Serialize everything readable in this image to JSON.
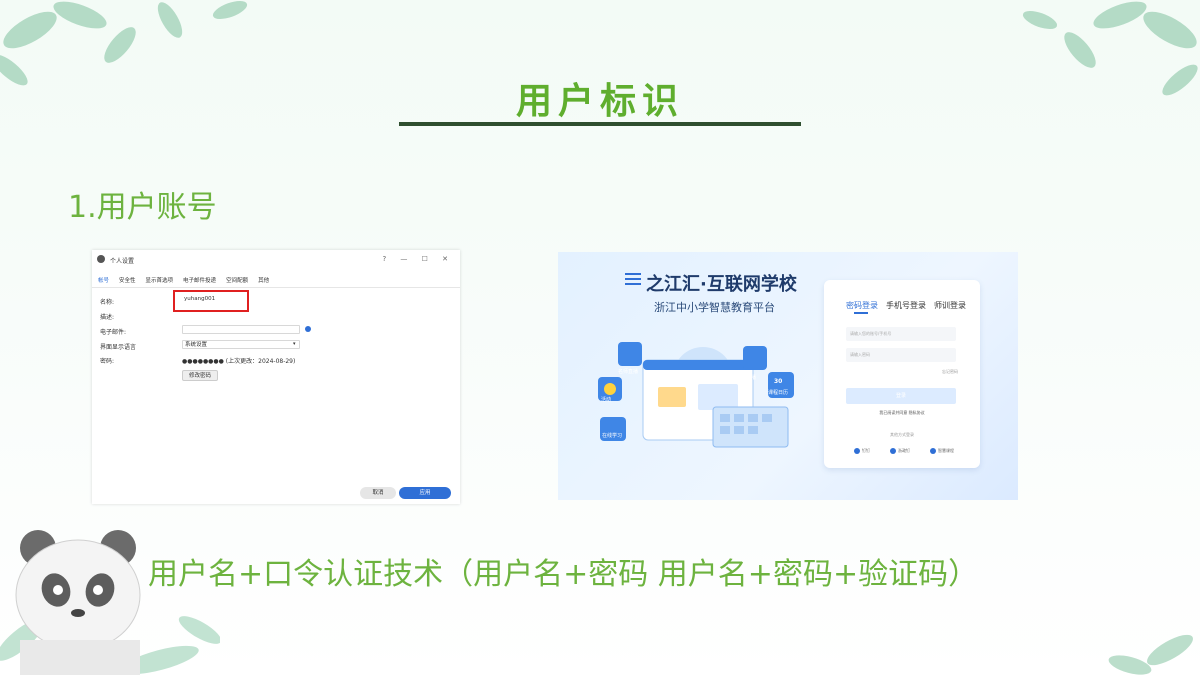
{
  "slide": {
    "title": "用户标识",
    "subtitle": "1.用户账号",
    "bottom_text": "用户名+口令认证技术（用户名+密码 用户名+密码+验证码）"
  },
  "settings_dialog": {
    "window_title": "个人设置",
    "controls": "? — ☐ ✕",
    "tabs": [
      "帐号",
      "安全性",
      "显示首选项",
      "电子邮件投递",
      "空间配额",
      "其他"
    ],
    "fields": {
      "name_label": "名称:",
      "name_value": "yuhang001",
      "desc_label": "描述:",
      "email_label": "电子邮件:",
      "lang_label": "界面显示语言",
      "lang_value": "系统设置",
      "password_label": "密码:",
      "password_value": "●●●●●●●● (上次更改：2024-08-29)"
    },
    "change_password_button": "修改密码",
    "cancel_button": "取消",
    "apply_button": "应用"
  },
  "login_page": {
    "brand": "之江汇·互联网学校",
    "brand_sub": "浙江中小学智慧教育平台",
    "tabs": [
      "密码登录",
      "手机号登录",
      "师训登录"
    ],
    "username_placeholder": "请输入您的账号/手机号",
    "password_placeholder": "请输入密码",
    "forgot": "忘记密码",
    "login_button": "登录",
    "register_text": "我已阅读并同意 隐私协议",
    "other_login_text": "其他方式登录",
    "other_logins": [
      "钉钉",
      "浙政钉",
      "智慧课程"
    ],
    "illustration_labels": [
      "名师直播",
      "直播",
      "30",
      "课程日历",
      "活动",
      "在线学习"
    ]
  },
  "colors": {
    "title_green": "#5fae2e",
    "text_green": "#6db33f",
    "highlight_red": "#e02020",
    "accent_blue": "#2f6fd6"
  }
}
